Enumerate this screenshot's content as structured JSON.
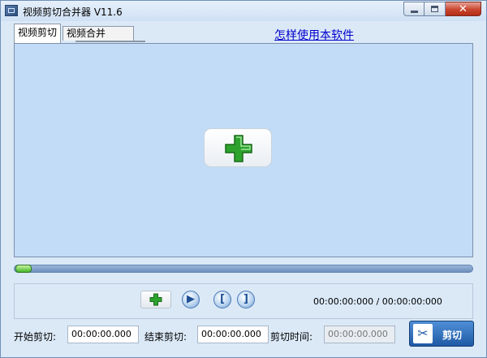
{
  "window": {
    "title": "视频剪切合并器 V11.6",
    "close_glyph": "✕"
  },
  "tabs": [
    {
      "label": "视频剪切"
    },
    {
      "label": "视频合并"
    }
  ],
  "help_link": "怎样使用本软件",
  "player": {
    "position_fraction": 0,
    "time_readout": "00:00:00:000 / 00:00:00:000"
  },
  "controls": {
    "mark_start_glyph": "[",
    "mark_end_glyph": "]",
    "play_glyph": "▶"
  },
  "cut_fields": {
    "start_label": "开始剪切:",
    "start_value": "00:00:00.000",
    "end_label": "结束剪切:",
    "end_value": "00:00:00.000",
    "duration_label": "剪切时间:",
    "duration_value": "00:00:00.000"
  },
  "cut_button": {
    "label": "剪切",
    "icon_glyph": "✂"
  },
  "colors": {
    "accent": "#1f5aa5",
    "preview_bg": "#c2dcf7",
    "plus_green": "#2da32d"
  }
}
